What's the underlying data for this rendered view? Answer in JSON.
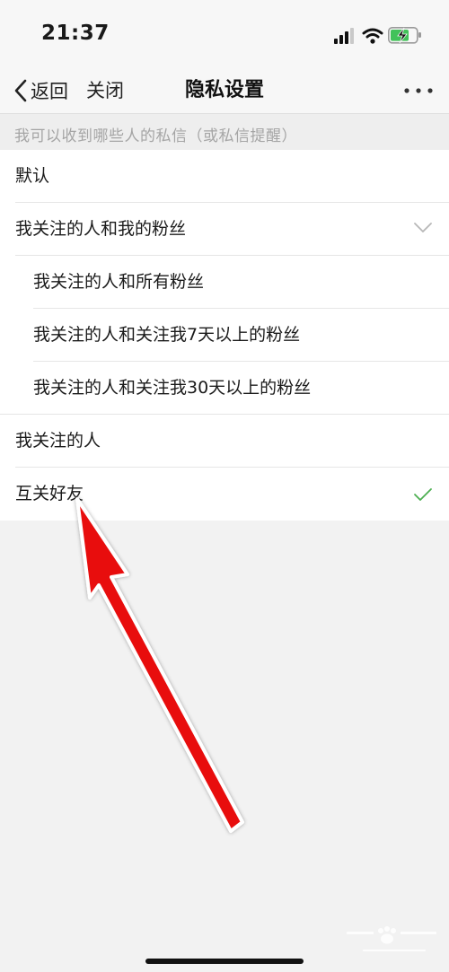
{
  "status_bar": {
    "time": "21:37"
  },
  "nav": {
    "back_label": "返回",
    "close_label": "关闭",
    "title": "隐私设置"
  },
  "section": {
    "header": "我可以收到哪些人的私信（或私信提醒）"
  },
  "options": [
    {
      "label": "默认",
      "indent": false,
      "state": "none"
    },
    {
      "label": "我关注的人和我的粉丝",
      "indent": false,
      "state": "expanded"
    },
    {
      "label": "我关注的人和所有粉丝",
      "indent": true,
      "state": "none"
    },
    {
      "label": "我关注的人和关注我7天以上的粉丝",
      "indent": true,
      "state": "none"
    },
    {
      "label": "我关注的人和关注我30天以上的粉丝",
      "indent": true,
      "state": "none"
    },
    {
      "label": "我关注的人",
      "indent": false,
      "state": "none"
    },
    {
      "label": "互关好友",
      "indent": false,
      "state": "selected"
    }
  ],
  "colors": {
    "check": "#4caf50",
    "annotation_arrow": "#e81010"
  },
  "icons": {
    "back": "chevron-left-icon",
    "more": "more-dots-icon",
    "expanded": "chevron-down-icon",
    "selected": "checkmark-icon"
  }
}
